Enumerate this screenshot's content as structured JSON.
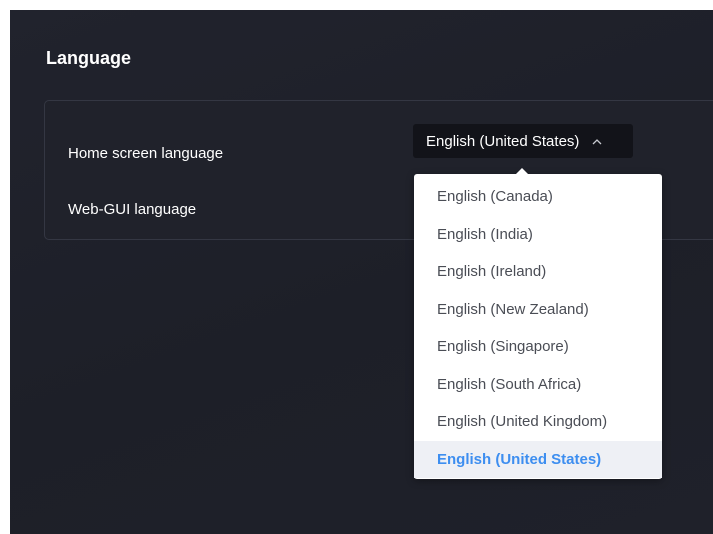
{
  "section": {
    "title": "Language"
  },
  "settings": {
    "home_screen_label": "Home screen language",
    "web_gui_label": "Web-GUI language"
  },
  "select": {
    "current_value": "English (United States)",
    "chevron_icon": "chevron-up-icon",
    "options": [
      "English (Canada)",
      "English (India)",
      "English (Ireland)",
      "English (New Zealand)",
      "English (Singapore)",
      "English (South Africa)",
      "English (United Kingdom)",
      "English (United States)"
    ],
    "selected_index": 7
  },
  "colors": {
    "background": "#1f212a",
    "card_border": "#343743",
    "trigger_bg": "#121319",
    "option_text": "#4a4d55",
    "selected_text": "#3d8ef0",
    "selected_bg": "#eef0f5"
  }
}
